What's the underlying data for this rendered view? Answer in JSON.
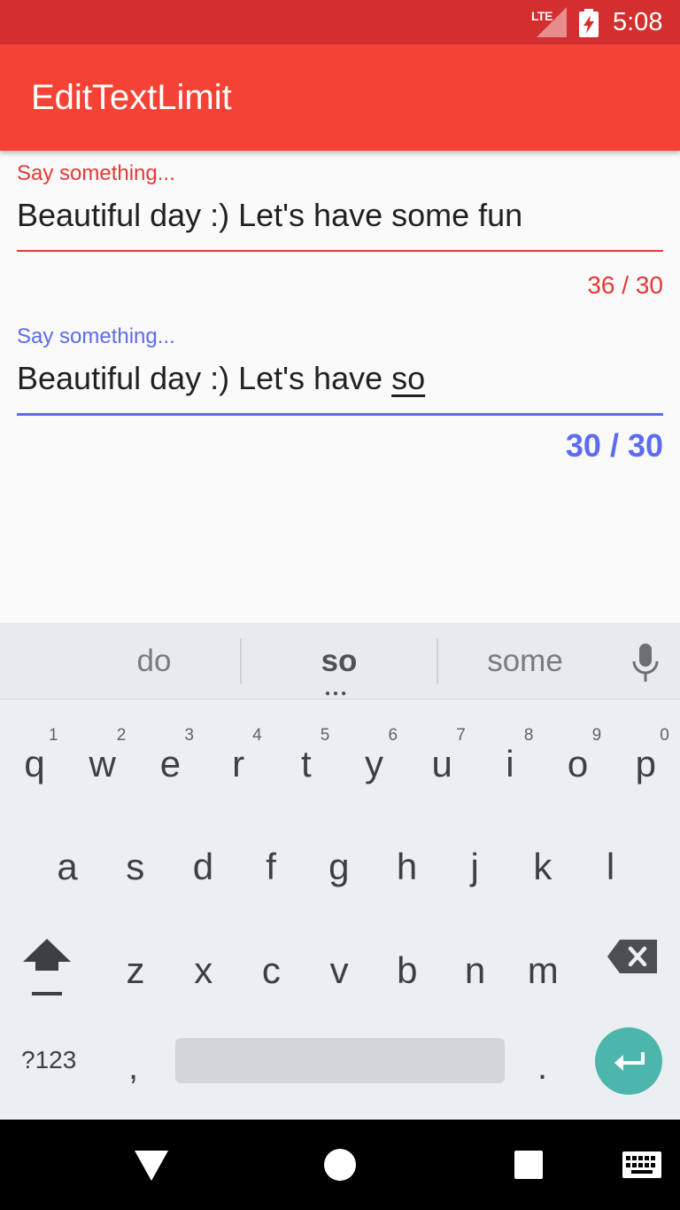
{
  "status": {
    "network": "LTE",
    "time": "5:08"
  },
  "app": {
    "title": "EditTextLimit"
  },
  "fields": [
    {
      "label": "Say something...",
      "value": "Beautiful day :) Let's have some fun",
      "counter": "36 / 30",
      "state": "error"
    },
    {
      "label": "Say something...",
      "value_prefix": "Beautiful day :) Let's have ",
      "composing": "so",
      "counter": "30 / 30",
      "state": "focused"
    }
  ],
  "keyboard": {
    "suggestions": [
      "do",
      "so",
      "some"
    ],
    "row1": [
      {
        "key": "q",
        "hint": "1"
      },
      {
        "key": "w",
        "hint": "2"
      },
      {
        "key": "e",
        "hint": "3"
      },
      {
        "key": "r",
        "hint": "4"
      },
      {
        "key": "t",
        "hint": "5"
      },
      {
        "key": "y",
        "hint": "6"
      },
      {
        "key": "u",
        "hint": "7"
      },
      {
        "key": "i",
        "hint": "8"
      },
      {
        "key": "o",
        "hint": "9"
      },
      {
        "key": "p",
        "hint": "0"
      }
    ],
    "row2": [
      "a",
      "s",
      "d",
      "f",
      "g",
      "h",
      "j",
      "k",
      "l"
    ],
    "row3": [
      "z",
      "x",
      "c",
      "v",
      "b",
      "n",
      "m"
    ],
    "symbols_label": "?123",
    "comma": ",",
    "period": "."
  },
  "colors": {
    "status_bar": "#d32f2f",
    "app_bar": "#f44336",
    "error": "#e53935",
    "accent": "#5c6bf0",
    "enter_key": "#4db6ac"
  },
  "icons": [
    "signal-icon",
    "battery-charging-icon",
    "mic-icon",
    "shift-icon",
    "backspace-icon",
    "enter-icon",
    "back-icon",
    "home-icon",
    "recents-icon",
    "keyboard-icon"
  ]
}
